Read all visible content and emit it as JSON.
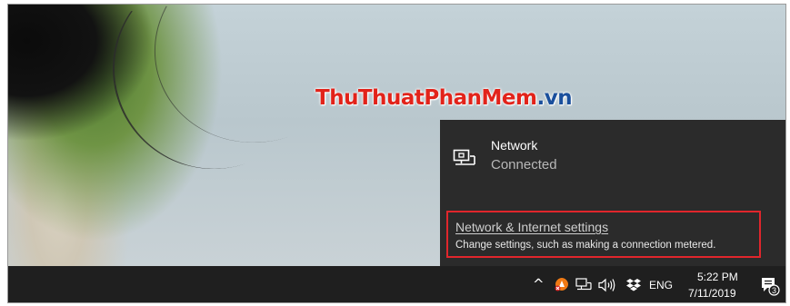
{
  "watermark": {
    "part1": "ThuThuat",
    "part2": "PhanMem",
    "part3": ".vn"
  },
  "network": {
    "name": "Network",
    "status": "Connected",
    "settings_link": "Network & Internet settings",
    "settings_description": "Change settings, such as making a connection metered."
  },
  "taskbar": {
    "chevron": "^",
    "language": "ENG",
    "time": "5:22 PM",
    "date": "7/11/2019",
    "notification_count": "3"
  },
  "icons": {
    "chevron": "chevron-up-icon",
    "antivirus": "avast-icon",
    "network": "ethernet-icon",
    "volume": "speaker-icon",
    "dropbox": "dropbox-icon",
    "notifications": "action-center-icon"
  },
  "colors": {
    "flyout_bg": "#2b2b2b",
    "taskbar_bg": "#1f1f1f",
    "highlight_box": "#e0262c",
    "watermark_red": "#e2231a",
    "watermark_blue": "#1a4f9c"
  }
}
